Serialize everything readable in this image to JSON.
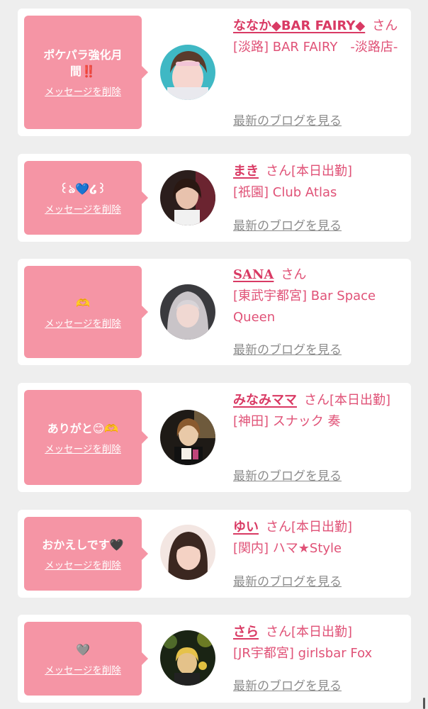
{
  "accent_color": "#d93a64",
  "bubble_color": "#f595a5",
  "cards": [
    {
      "message": "ポケパラ強化月間‼️",
      "delete_label": "メッセージを削除",
      "name": "ななか◆BAR FAIRY◆",
      "suffix": "さん",
      "store": "[淡路] BAR FAIRY　-淡路店-",
      "blog_label": "最新のブログを見る"
    },
    {
      "message": "꒰ঌ💙໒꒱",
      "delete_label": "メッセージを削除",
      "name": "まき",
      "suffix": "さん[本日出勤]",
      "store": "[祇園] Club Atlas",
      "blog_label": "最新のブログを見る"
    },
    {
      "message": "🫶",
      "delete_label": "メッセージを削除",
      "name": "SANA",
      "suffix": "さん",
      "store": "[東武宇都宮] Bar Space Queen",
      "blog_label": "最新のブログを見る"
    },
    {
      "message": "ありがと😊🫶",
      "delete_label": "メッセージを削除",
      "name": "みなみママ",
      "suffix": "さん[本日出勤]",
      "store": "[神田] スナック 奏",
      "blog_label": "最新のブログを見る"
    },
    {
      "message": "おかえしです🖤",
      "delete_label": "メッセージを削除",
      "name": "ゆい",
      "suffix": "さん[本日出勤]",
      "store": "[関内] ハマ★Style",
      "blog_label": "最新のブログを見る"
    },
    {
      "message": "🩶",
      "delete_label": "メッセージを削除",
      "name": "さら",
      "suffix": "さん[本日出勤]",
      "store": "[JR宇都宮] girlsbar Fox",
      "blog_label": "最新のブログを見る"
    }
  ]
}
